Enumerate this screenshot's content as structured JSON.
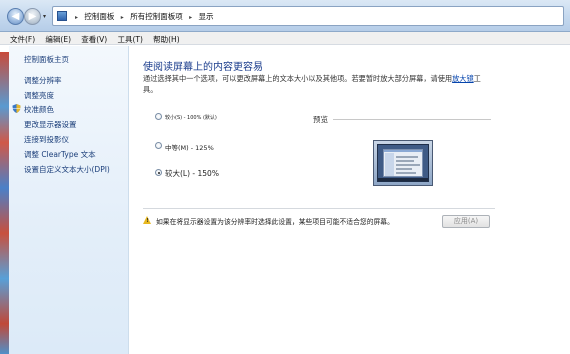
{
  "address": {
    "back_glyph": "◀",
    "forward_glyph": "▶",
    "dropdown_glyph": "▾",
    "sep_glyph": "▸",
    "crumbs": [
      "控制面板",
      "所有控制面板项",
      "显示"
    ]
  },
  "menu": [
    "文件(F)",
    "编辑(E)",
    "查看(V)",
    "工具(T)",
    "帮助(H)"
  ],
  "sidebar": {
    "items": [
      {
        "label": "控制面板主页"
      },
      {
        "label": "调整分辨率"
      },
      {
        "label": "调整亮度"
      },
      {
        "label": "校准颜色",
        "icon": "shield-icon"
      },
      {
        "label": "更改显示器设置"
      },
      {
        "label": "连接到投影仪"
      },
      {
        "label": "调整 ClearType 文本"
      },
      {
        "label": "设置自定义文本大小(DPI)"
      }
    ]
  },
  "main": {
    "title": "使阅读屏幕上的内容更容易",
    "description": "通过选择其中一个选项，可以更改屏幕上的文本大小以及其他项。若要暂时放大部分屏幕，请使用",
    "magnifier_link": "放大镜",
    "description_tail": "工具。",
    "options": [
      {
        "label": "较小(S) - 100% (默认)",
        "checked": false
      },
      {
        "label": "中等(M) - 125%",
        "checked": false
      },
      {
        "label": "较大(L) - 150%",
        "checked": true
      }
    ],
    "preview_label": "预览",
    "warning_mark": "!",
    "warning": "如果在将显示器设置为该分辨率时选择此设置，某些项目可能不适合您的屏幕。",
    "apply_button": "应用(A)"
  }
}
